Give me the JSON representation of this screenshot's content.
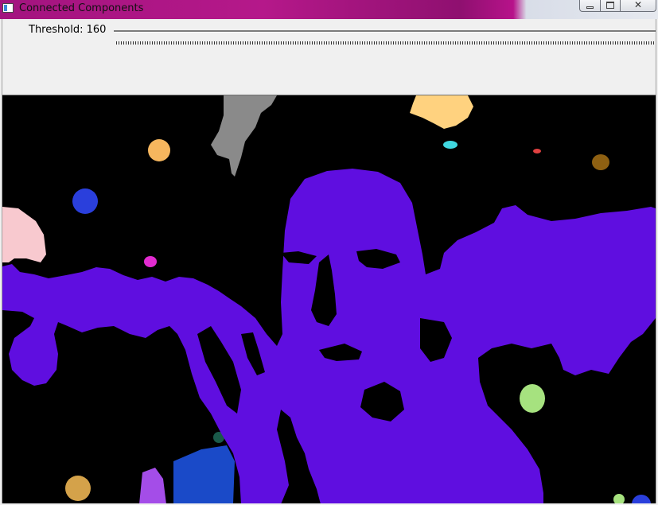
{
  "window": {
    "title": "Connected Components",
    "icon": "window-app-icon",
    "controls": {
      "minimize_icon": "minimize-icon",
      "maximize_icon": "maximize-icon",
      "close_glyph": "✕"
    }
  },
  "trackbar": {
    "label": "Threshold: 160",
    "value": 160
  },
  "image": {
    "background": "#000000",
    "main_component_color": "#5f0ee0",
    "component_colors": [
      "#5f0ee0",
      "#8a8a8a",
      "#ffd27f",
      "#f8c9cf",
      "#2a3fdc",
      "#f6b65e",
      "#a6e27f",
      "#a44de8",
      "#1a4ac8",
      "#d4a24a",
      "#8e6012",
      "#e22bd0",
      "#40d8e0",
      "#1a5a4a"
    ]
  }
}
